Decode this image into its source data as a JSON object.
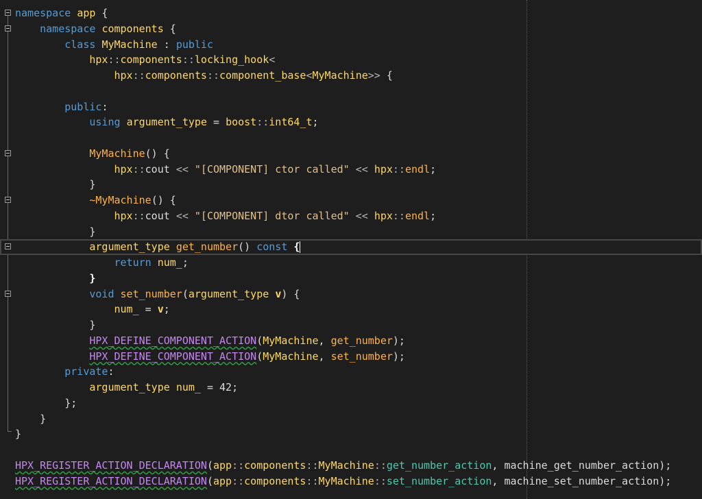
{
  "editor": {
    "lines": [
      {
        "fold": true,
        "tokens": [
          [
            "kw",
            "namespace"
          ],
          [
            "pl",
            " "
          ],
          [
            "ty",
            "app"
          ],
          [
            "pl",
            " {"
          ]
        ]
      },
      {
        "fold": true,
        "tokens": [
          [
            "pl",
            "    "
          ],
          [
            "kw",
            "namespace"
          ],
          [
            "pl",
            " "
          ],
          [
            "ty",
            "components"
          ],
          [
            "pl",
            " {"
          ]
        ]
      },
      {
        "fold": false,
        "tokens": [
          [
            "pl",
            "        "
          ],
          [
            "kw",
            "class"
          ],
          [
            "pl",
            " "
          ],
          [
            "ty",
            "MyMachine"
          ],
          [
            "pl",
            " : "
          ],
          [
            "kw",
            "public"
          ]
        ]
      },
      {
        "fold": false,
        "tokens": [
          [
            "pl",
            "            "
          ],
          [
            "ty",
            "hpx"
          ],
          [
            "op",
            "::"
          ],
          [
            "ty",
            "components"
          ],
          [
            "op",
            "::"
          ],
          [
            "ty",
            "locking_hook"
          ],
          [
            "op",
            "<"
          ]
        ]
      },
      {
        "fold": false,
        "tokens": [
          [
            "pl",
            "                "
          ],
          [
            "ty",
            "hpx"
          ],
          [
            "op",
            "::"
          ],
          [
            "ty",
            "components"
          ],
          [
            "op",
            "::"
          ],
          [
            "ty",
            "component_base"
          ],
          [
            "op",
            "<"
          ],
          [
            "ty",
            "MyMachine"
          ],
          [
            "op",
            ">>"
          ],
          [
            "pl",
            " {"
          ]
        ]
      },
      {
        "fold": false,
        "tokens": []
      },
      {
        "fold": false,
        "tokens": [
          [
            "pl",
            "        "
          ],
          [
            "kw",
            "public"
          ],
          [
            "pl",
            ":"
          ]
        ]
      },
      {
        "fold": false,
        "tokens": [
          [
            "pl",
            "            "
          ],
          [
            "kw",
            "using"
          ],
          [
            "pl",
            " "
          ],
          [
            "ty",
            "argument_type"
          ],
          [
            "pl",
            " = "
          ],
          [
            "ty",
            "boost"
          ],
          [
            "op",
            "::"
          ],
          [
            "ty",
            "int64_t"
          ],
          [
            "pl",
            ";"
          ]
        ]
      },
      {
        "fold": false,
        "tokens": []
      },
      {
        "fold": true,
        "tokens": [
          [
            "pl",
            "            "
          ],
          [
            "fn",
            "MyMachine"
          ],
          [
            "pl",
            "() {"
          ]
        ]
      },
      {
        "fold": false,
        "tokens": [
          [
            "pl",
            "                "
          ],
          [
            "ty",
            "hpx"
          ],
          [
            "op",
            "::"
          ],
          [
            "cn",
            "cout"
          ],
          [
            "pl",
            " "
          ],
          [
            "op",
            "<<"
          ],
          [
            "pl",
            " "
          ],
          [
            "st",
            "\"[COMPONENT] ctor called\""
          ],
          [
            "pl",
            " "
          ],
          [
            "op",
            "<<"
          ],
          [
            "pl",
            " "
          ],
          [
            "ty",
            "hpx"
          ],
          [
            "op",
            "::"
          ],
          [
            "fn",
            "endl"
          ],
          [
            "pl",
            ";"
          ]
        ]
      },
      {
        "fold": false,
        "tokens": [
          [
            "pl",
            "            }"
          ]
        ]
      },
      {
        "fold": true,
        "tokens": [
          [
            "pl",
            "            "
          ],
          [
            "fn",
            "~MyMachine"
          ],
          [
            "pl",
            "() {"
          ]
        ]
      },
      {
        "fold": false,
        "tokens": [
          [
            "pl",
            "                "
          ],
          [
            "ty",
            "hpx"
          ],
          [
            "op",
            "::"
          ],
          [
            "cn",
            "cout"
          ],
          [
            "pl",
            " "
          ],
          [
            "op",
            "<<"
          ],
          [
            "pl",
            " "
          ],
          [
            "st",
            "\"[COMPONENT] dtor called\""
          ],
          [
            "pl",
            " "
          ],
          [
            "op",
            "<<"
          ],
          [
            "pl",
            " "
          ],
          [
            "ty",
            "hpx"
          ],
          [
            "op",
            "::"
          ],
          [
            "fn",
            "endl"
          ],
          [
            "pl",
            ";"
          ]
        ]
      },
      {
        "fold": false,
        "tokens": [
          [
            "pl",
            "            }"
          ]
        ]
      },
      {
        "fold": true,
        "current": true,
        "tokens": [
          [
            "pl",
            "            "
          ],
          [
            "ty",
            "argument_type"
          ],
          [
            "pl",
            " "
          ],
          [
            "fn",
            "get_number"
          ],
          [
            "pl",
            "() "
          ],
          [
            "kw",
            "const"
          ],
          [
            "pl",
            " "
          ],
          [
            "bm",
            "{"
          ]
        ]
      },
      {
        "fold": false,
        "tokens": [
          [
            "pl",
            "                "
          ],
          [
            "kw",
            "return"
          ],
          [
            "pl",
            " "
          ],
          [
            "mb",
            "num_"
          ],
          [
            "pl",
            ";"
          ]
        ]
      },
      {
        "fold": false,
        "tokens": [
          [
            "pl",
            "            "
          ],
          [
            "bm",
            "}"
          ]
        ]
      },
      {
        "fold": true,
        "tokens": [
          [
            "pl",
            "            "
          ],
          [
            "kw",
            "void"
          ],
          [
            "pl",
            " "
          ],
          [
            "fn",
            "set_number"
          ],
          [
            "pl",
            "("
          ],
          [
            "ty",
            "argument_type"
          ],
          [
            "pl",
            " "
          ],
          [
            "pm",
            "v"
          ],
          [
            "pl",
            ") {"
          ]
        ]
      },
      {
        "fold": false,
        "tokens": [
          [
            "pl",
            "                "
          ],
          [
            "mb",
            "num_"
          ],
          [
            "pl",
            " = "
          ],
          [
            "pm",
            "v"
          ],
          [
            "pl",
            ";"
          ]
        ]
      },
      {
        "fold": false,
        "tokens": [
          [
            "pl",
            "            }"
          ]
        ]
      },
      {
        "fold": false,
        "tokens": [
          [
            "pl",
            "            "
          ],
          [
            "mcs",
            "HPX_DEFINE_COMPONENT_ACTION"
          ],
          [
            "pl",
            "("
          ],
          [
            "ty",
            "MyMachine"
          ],
          [
            "pl",
            ", "
          ],
          [
            "fn",
            "get_number"
          ],
          [
            "pl",
            ");"
          ]
        ]
      },
      {
        "fold": false,
        "tokens": [
          [
            "pl",
            "            "
          ],
          [
            "mcs",
            "HPX_DEFINE_COMPONENT_ACTION"
          ],
          [
            "pl",
            "("
          ],
          [
            "ty",
            "MyMachine"
          ],
          [
            "pl",
            ", "
          ],
          [
            "fn",
            "set_number"
          ],
          [
            "pl",
            ");"
          ]
        ]
      },
      {
        "fold": false,
        "tokens": [
          [
            "pl",
            "        "
          ],
          [
            "kw",
            "private"
          ],
          [
            "pl",
            ":"
          ]
        ]
      },
      {
        "fold": false,
        "tokens": [
          [
            "pl",
            "            "
          ],
          [
            "ty",
            "argument_type"
          ],
          [
            "pl",
            " "
          ],
          [
            "mb",
            "num_"
          ],
          [
            "pl",
            " = 42;"
          ]
        ]
      },
      {
        "fold": false,
        "tokens": [
          [
            "pl",
            "        };"
          ]
        ]
      },
      {
        "fold": false,
        "tokens": [
          [
            "pl",
            "    }"
          ]
        ]
      },
      {
        "fold": false,
        "tokens": [
          [
            "pl",
            "}"
          ]
        ]
      },
      {
        "fold": false,
        "tokens": []
      },
      {
        "fold": false,
        "tokens": [
          [
            "mcs",
            "HPX_REGISTER_ACTION_DECLARATION"
          ],
          [
            "pl",
            "("
          ],
          [
            "ty",
            "app"
          ],
          [
            "op",
            "::"
          ],
          [
            "ty",
            "components"
          ],
          [
            "op",
            "::"
          ],
          [
            "ty",
            "MyMachine"
          ],
          [
            "op",
            "::"
          ],
          [
            "kwt",
            "get_number_action"
          ],
          [
            "pl",
            ", "
          ],
          [
            "cn",
            "machine_get_number_action"
          ],
          [
            "pl",
            ");"
          ]
        ]
      },
      {
        "fold": false,
        "tokens": [
          [
            "mcs",
            "HPX_REGISTER_ACTION_DECLARATION"
          ],
          [
            "pl",
            "("
          ],
          [
            "ty",
            "app"
          ],
          [
            "op",
            "::"
          ],
          [
            "ty",
            "components"
          ],
          [
            "op",
            "::"
          ],
          [
            "ty",
            "MyMachine"
          ],
          [
            "op",
            "::"
          ],
          [
            "kwt",
            "set_number_action"
          ],
          [
            "pl",
            ", "
          ],
          [
            "cn",
            "machine_set_number_action"
          ],
          [
            "pl",
            ");"
          ]
        ]
      }
    ]
  },
  "colors": {
    "background": "#1e1e1e",
    "keyword": "#569cd6",
    "type": "#ffd866",
    "function": "#ffb347",
    "macro": "#c586f0",
    "string": "#e2c08d",
    "nested_type": "#4ec9b0",
    "squiggle": "#2ea043"
  }
}
